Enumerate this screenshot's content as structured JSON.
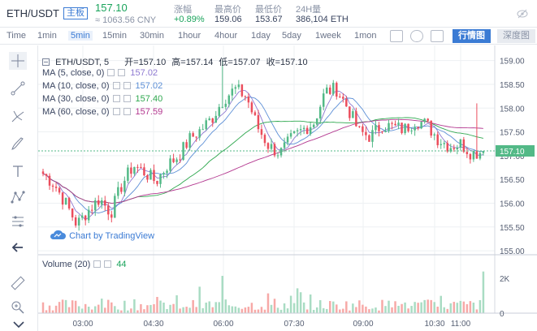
{
  "header": {
    "symbol": "ETH/USDT",
    "board": "主板",
    "price": "157.10",
    "cny": "≈ 1063.56 CNY",
    "stats": [
      {
        "label": "涨幅",
        "value": "+0.89%"
      },
      {
        "label": "最高价",
        "value": "159.06"
      },
      {
        "label": "最低价",
        "value": "153.67"
      },
      {
        "label": "24H量",
        "value": "386,104 ETH"
      }
    ]
  },
  "toolbar": {
    "timeframes": [
      "Time",
      "1min",
      "5min",
      "15min",
      "30min",
      "1hour",
      "4hour",
      "1day",
      "5day",
      "1week",
      "1mon"
    ],
    "active": "5min",
    "view_buttons": [
      "行情图",
      "深度图"
    ]
  },
  "tools": [
    "crosshair-icon",
    "trendline-icon",
    "pitchfork-icon",
    "brush-icon",
    "text-icon",
    "pattern-icon",
    "measure-icon",
    "back-arrow-icon",
    "ruler-icon",
    "zoom-icon"
  ],
  "legend": {
    "title": "ETH/USDT, 5",
    "open_label": "开",
    "open": "=157.10",
    "high_label": "高",
    "high": "=157.14",
    "low_label": "低",
    "low": "=157.07",
    "close_label": "收",
    "close": "=157.10",
    "ma": [
      {
        "label": "MA (5, close, 0)",
        "value": "157.02",
        "color": "#8e79d1"
      },
      {
        "label": "MA (10, close, 0)",
        "value": "157.02",
        "color": "#5c8fd6"
      },
      {
        "label": "MA (30, close, 0)",
        "value": "157.40",
        "color": "#2fa84f"
      },
      {
        "label": "MA (60, close, 0)",
        "value": "157.59",
        "color": "#b3378f"
      }
    ]
  },
  "volume_legend": {
    "label": "Volume (20)",
    "value": "44"
  },
  "watermark": "Chart by TradingView",
  "colors": {
    "up": "#53b987",
    "down": "#eb4d5c",
    "vup": "#a9dcc3",
    "vdown": "#f7a9a7",
    "accent": "#3b7bd4"
  },
  "chart_data": [
    {
      "type": "candlestick",
      "title": "ETH/USDT, 5",
      "yticks": [
        "159.00",
        "158.50",
        "158.00",
        "157.50",
        "157.00",
        "156.50",
        "156.00",
        "155.50",
        "155.00"
      ],
      "ylim": [
        154.95,
        159.25
      ],
      "last_price": "157.10",
      "last_price_value": 157.1,
      "xticks": [
        "03:00",
        "04:30",
        "06:00",
        "07:30",
        "09:00",
        "10:30",
        "11:00"
      ],
      "anchors": [
        156.62,
        156.4,
        156.0,
        155.55,
        155.85,
        156.1,
        155.8,
        156.4,
        156.8,
        156.65,
        156.45,
        156.8,
        157.0,
        157.35,
        157.55,
        157.8,
        158.2,
        158.4,
        158.25,
        157.6,
        157.2,
        157.05,
        157.35,
        157.55,
        157.7,
        158.35,
        158.4,
        158.0,
        157.5,
        157.4,
        157.65,
        157.6,
        157.55,
        157.75,
        157.65,
        157.35,
        157.2,
        157.25,
        157.05,
        157.1
      ],
      "spikes": [
        {
          "at": 55,
          "high": 159.0
        },
        {
          "at": 133,
          "high": 158.1
        }
      ]
    },
    {
      "type": "bar",
      "title": "Volume (20)",
      "yticks": [
        "2K",
        "0"
      ],
      "ylim": [
        0,
        2900
      ],
      "last_volume": 2400
    }
  ]
}
